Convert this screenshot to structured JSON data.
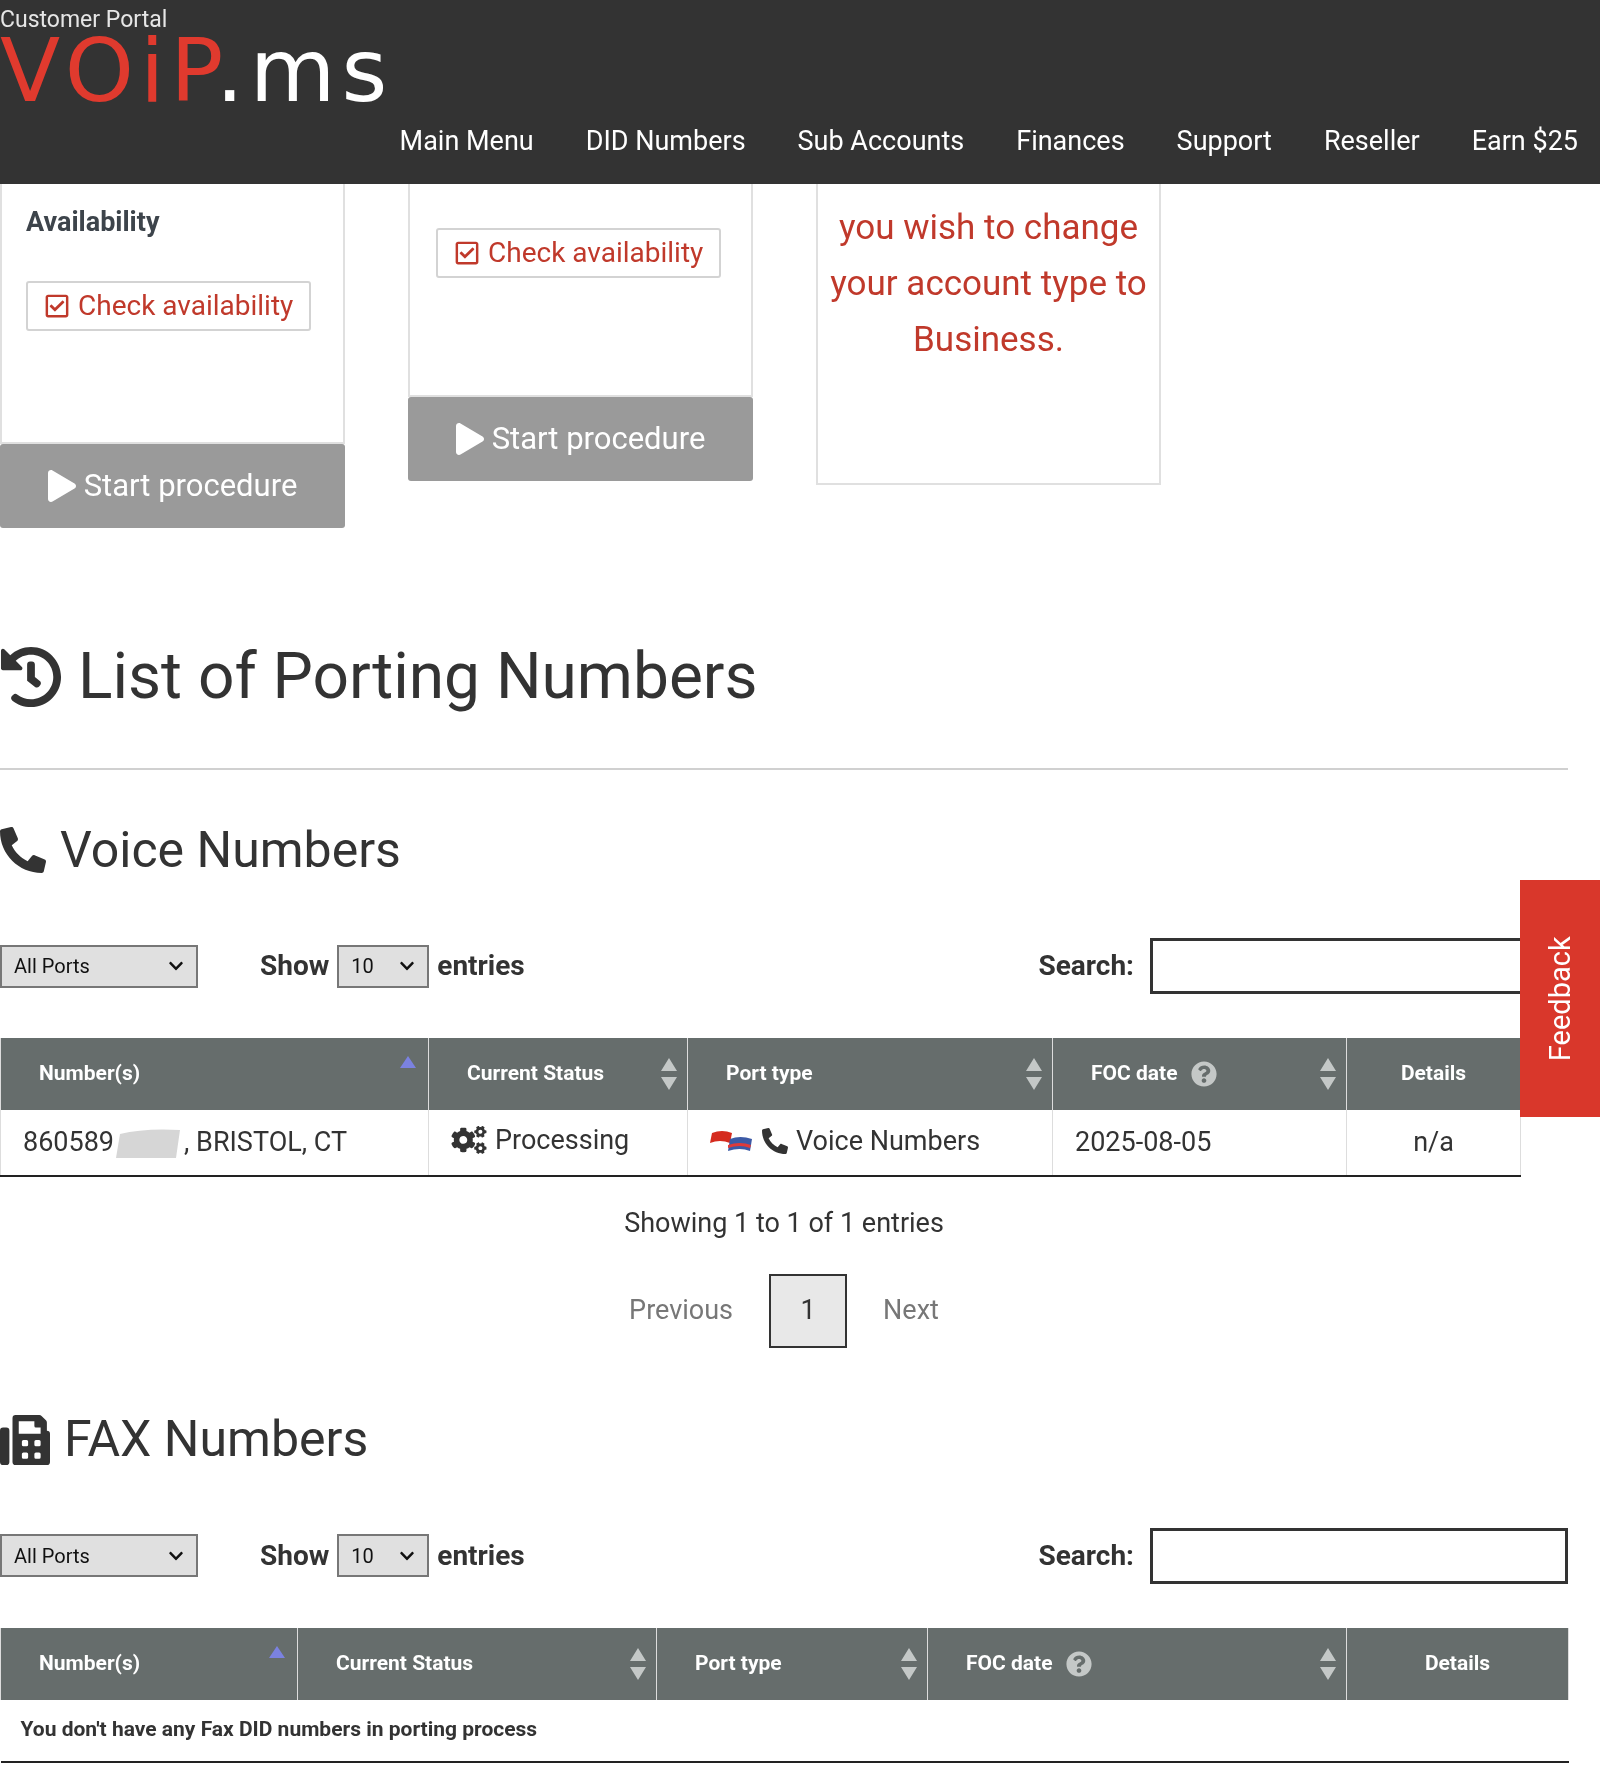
{
  "header": {
    "subtitle": "Customer Portal",
    "logo": [
      "VOiP",
      ".ms"
    ],
    "nav": [
      "Main Menu",
      "DID Numbers",
      "Sub Accounts",
      "Finances",
      "Support",
      "Reseller",
      "Earn $25"
    ]
  },
  "cards": [
    {
      "heading": "Availability",
      "check": "Check availability",
      "action": "Start procedure"
    },
    {
      "check": "Check availability",
      "action": "Start procedure"
    },
    {
      "message": "you wish to change your account type to Business."
    }
  ],
  "title": "List of Porting Numbers",
  "sections": [
    {
      "kind": "voice",
      "title": "Voice Numbers",
      "filter": "All Ports",
      "show_label": "Show",
      "page_size": "10",
      "entries_label": "entries",
      "search_label": "Search:",
      "columns": [
        {
          "label": "Number(s)",
          "sortable": true,
          "sorted": true
        },
        {
          "label": "Current Status",
          "sortable": true,
          "sorted": false
        },
        {
          "label": "Port type",
          "sortable": true,
          "sorted": false
        },
        {
          "label": "FOC date",
          "sortable": true,
          "sorted": false,
          "help": true
        },
        {
          "label": "Details",
          "sortable": false,
          "sorted": false
        }
      ],
      "rows": [
        {
          "number_prefix": "860589",
          "location": ", BRISTOL, CT",
          "status": "Processing",
          "port_type": "Voice Numbers",
          "foc_date": "2025-08-05",
          "details": "n/a"
        }
      ],
      "info": "Showing 1 to 1 of 1 entries",
      "pagination": [
        {
          "label": "Previous",
          "selected": false
        },
        {
          "label": "1",
          "selected": true
        },
        {
          "label": "Next",
          "selected": false
        }
      ]
    },
    {
      "kind": "fax",
      "title": "FAX Numbers",
      "filter": "All Ports",
      "show_label": "Show",
      "page_size": "10",
      "entries_label": "entries",
      "search_label": "Search:",
      "columns": [
        {
          "label": "Number(s)",
          "sortable": true,
          "sorted": true
        },
        {
          "label": "Current Status",
          "sortable": true,
          "sorted": false
        },
        {
          "label": "Port type",
          "sortable": true,
          "sorted": false
        },
        {
          "label": "FOC date",
          "sortable": true,
          "sorted": false,
          "help": true
        },
        {
          "label": "Details",
          "sortable": false,
          "sorted": false
        }
      ],
      "empty": "You don't have any Fax DID numbers in porting process"
    }
  ],
  "feedback": "Feedback"
}
